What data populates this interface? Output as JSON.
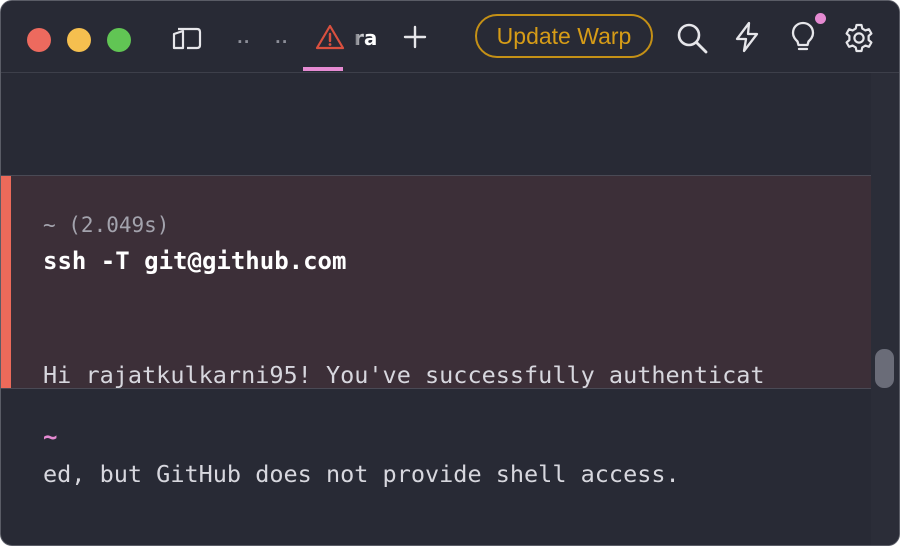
{
  "titlebar": {
    "tabs": [
      {
        "label": ".."
      },
      {
        "label": ".."
      }
    ],
    "active_tab": {
      "label": "ra"
    },
    "update_button": "Update Warp",
    "icons": {
      "pane": "split-pane-icon",
      "warning": "warning-icon",
      "new_tab": "plus-icon",
      "search": "search-icon",
      "lightning": "lightning-icon",
      "bulb": "lightbulb-icon",
      "settings": "gear-icon"
    },
    "colors": {
      "accent": "#e58ad2",
      "update": "#d69c17",
      "error": "#ec6a5a"
    }
  },
  "block": {
    "header": "~ (2.049s)",
    "command": "ssh -T git@github.com",
    "output_line1": "Hi rajatkulkarni95! You've successfully authenticat",
    "output_line2": "ed, but GitHub does not provide shell access."
  },
  "prompt": {
    "symbol": "~"
  }
}
